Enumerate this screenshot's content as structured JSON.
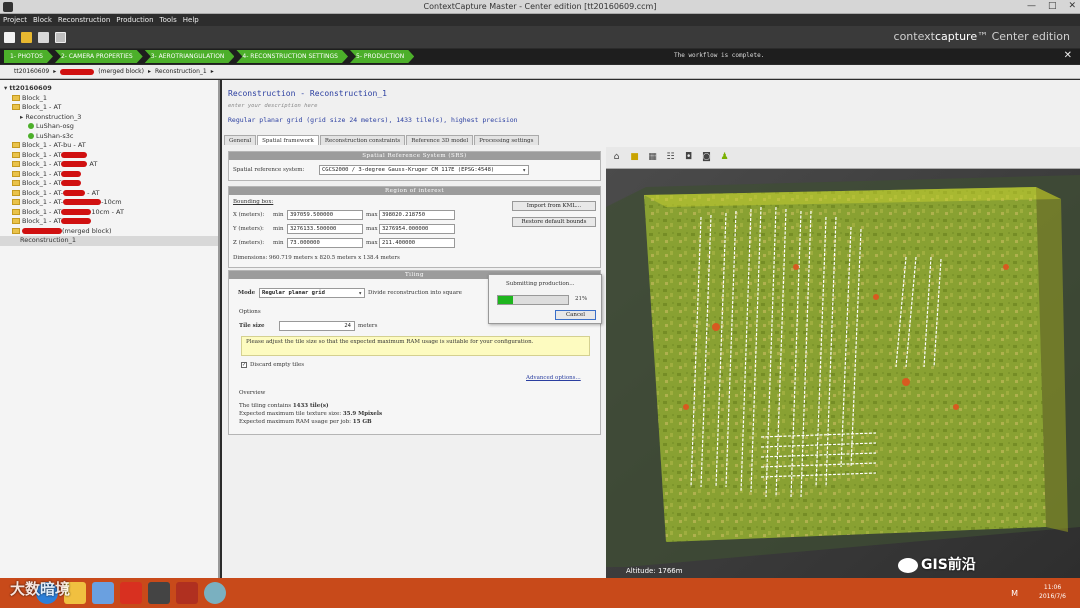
{
  "window": {
    "title": "ContextCapture Master - Center edition [tt20160609.ccm]",
    "minimize": "—",
    "maximize": "□",
    "close": "✕"
  },
  "menu": [
    "Project",
    "Block",
    "Reconstruction",
    "Production",
    "Tools",
    "Help"
  ],
  "brand": {
    "prefix": "context",
    "bold": "capture",
    "tm": "™",
    "edition": "Center edition"
  },
  "workflow": {
    "steps": [
      "1- PHOTOS",
      "2- CAMERA PROPERTIES",
      "3- AEROTRIANGULATION",
      "4- RECONSTRUCTION SETTINGS",
      "5- PRODUCTION"
    ],
    "message": "The workflow is complete.",
    "close": "✕"
  },
  "breadcrumb": {
    "project": "tt20160609",
    "sep1": "▸",
    "block_suffix": "(merged block)",
    "sep2": "▸",
    "recon": "Reconstruction_1",
    "sep3": "▸"
  },
  "tree": [
    {
      "label": "tt20160609",
      "indent": 0,
      "kind": "root"
    },
    {
      "label": "Block_1",
      "indent": 1,
      "kind": "folder"
    },
    {
      "label": "Block_1 - AT",
      "indent": 1,
      "kind": "folder"
    },
    {
      "label": "Reconstruction_3",
      "indent": 2,
      "kind": "recon"
    },
    {
      "label": "LuShan-osg",
      "indent": 3,
      "kind": "check"
    },
    {
      "label": "LuShan-s3c",
      "indent": 3,
      "kind": "check"
    },
    {
      "label": "Block_1 - AT-bu - AT",
      "indent": 1,
      "kind": "folder"
    },
    {
      "label": "Block_1 - AT",
      "indent": 1,
      "kind": "folder",
      "redact": 26
    },
    {
      "label": "Block_1 - AT",
      "indent": 1,
      "kind": "folder",
      "redact": 26,
      "tail": " AT"
    },
    {
      "label": "Block_1 - AT",
      "indent": 1,
      "kind": "folder",
      "redact": 20
    },
    {
      "label": "Block_1 - AT",
      "indent": 1,
      "kind": "folder",
      "redact": 20
    },
    {
      "label": "Block_1 - AT-",
      "indent": 1,
      "kind": "folder",
      "redact": 22,
      "tail": " - AT"
    },
    {
      "label": "Block_1 - AT-",
      "indent": 1,
      "kind": "folder",
      "redact": 38,
      "tail": "-10cm"
    },
    {
      "label": "Block_1 - AT",
      "indent": 1,
      "kind": "folder",
      "redact": 30,
      "tail": "10cm - AT"
    },
    {
      "label": "Block_1 - AT",
      "indent": 1,
      "kind": "folder",
      "redact": 30
    },
    {
      "label": "",
      "indent": 1,
      "kind": "folder",
      "redact": 40,
      "tail": "(merged block)"
    },
    {
      "label": "Reconstruction_1",
      "indent": 2,
      "kind": "plain",
      "selected": true
    }
  ],
  "main": {
    "title": "Reconstruction - Reconstruction_1",
    "desc": "enter your description here",
    "summary": "Regular planar grid (grid size 24 meters), 1433 tile(s), highest precision",
    "tabs": [
      "General",
      "Spatial framework",
      "Reconstruction constraints",
      "Reference 3D model",
      "Processing settings"
    ],
    "active_tab": 1
  },
  "srs": {
    "header": "Spatial Reference System (SRS)",
    "label": "Spatial reference system:",
    "value": "CGCS2000 / 3-degree Gauss-Kruger CM 117E (EPSG:4548)"
  },
  "roi": {
    "header": "Region of interest",
    "bbox_label": "Bounding box:",
    "rows": [
      {
        "axis": "X (meters):",
        "min_label": "min",
        "min": "397059.500000",
        "max_label": "max",
        "max": "398020.218750"
      },
      {
        "axis": "Y (meters):",
        "min_label": "min",
        "min": "3276133.500000",
        "max_label": "max",
        "max": "3276954.000000"
      },
      {
        "axis": "Z (meters):",
        "min_label": "min",
        "min": "73.000000",
        "max_label": "max",
        "max": "211.400000"
      }
    ],
    "dimensions": "Dimensions: 960.719 meters x 820.5 meters x 138.4 meters",
    "import_btn": "Import from KML...",
    "restore_btn": "Restore default bounds"
  },
  "tiling": {
    "header": "Tiling",
    "mode_label": "Mode",
    "mode_value": "Regular planar grid",
    "mode_desc": "Divide reconstruction into square",
    "options_label": "Options",
    "tile_size_label": "Tile size",
    "tile_size_value": "24",
    "tile_size_unit": "meters",
    "note": "Please adjust the tile size so that the expected maximum RAM usage is suitable for your configuration.",
    "discard_label": "Discard empty tiles",
    "advanced_link": "Advanced options...",
    "overview_label": "Overview",
    "overview_line1_pre": "The tiling contains ",
    "overview_line1_val": "1433 tile(s)",
    "overview_line2_pre": "Expected maximum tile texture size: ",
    "overview_line2_val": "35.9 Mpixels",
    "overview_line3_pre": "Expected maximum RAM usage per job: ",
    "overview_line3_val": "15 GB"
  },
  "popup": {
    "title": "Submitting production...",
    "progress": 0.21,
    "progress_label": "21%",
    "cancel": "Cancel"
  },
  "view": {
    "altitude": "Altitude: 1766m"
  },
  "watermarks": {
    "right": "GIS前沿",
    "left": "大数暗境"
  },
  "taskbar": {
    "time": "11:06",
    "date": "2016/7/6",
    "tray_letter": "M"
  }
}
